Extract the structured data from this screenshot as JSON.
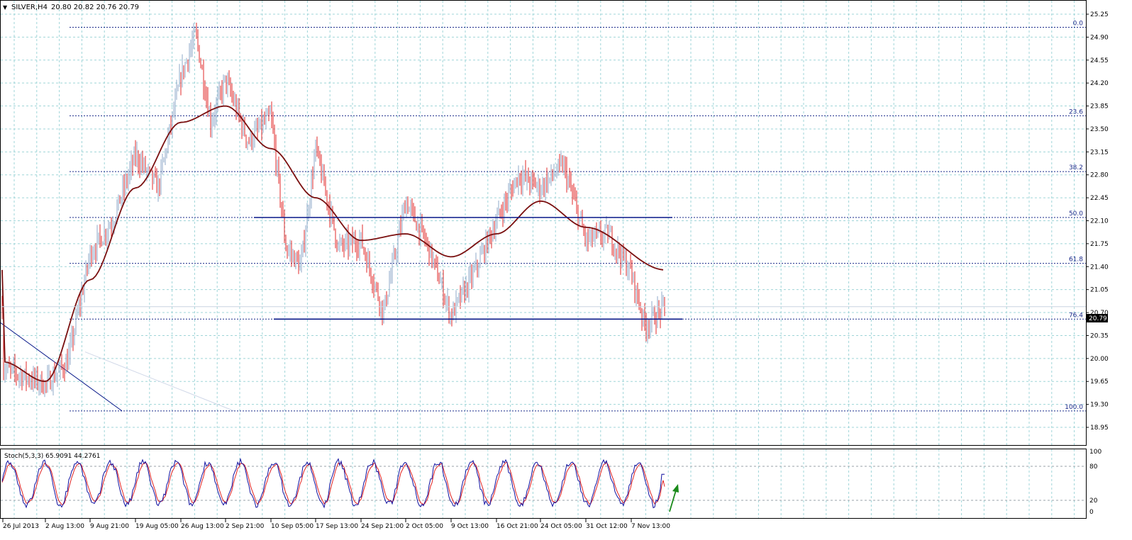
{
  "header": {
    "symbol": "SILVER,H4",
    "ohlc": "20.80 20.82 20.76 20.79",
    "stoch_label": "Stoch(5,3,3) 65.9091 44.2761"
  },
  "colors": {
    "background": "#ffffff",
    "grid": "#9fd5d8",
    "bull": "#8fa8c8",
    "bear": "#e0282a",
    "ma": "#7a1010",
    "level": "#0a1a8a",
    "fib": "#1a2a8a",
    "stoch_main": "#1010a0",
    "stoch_signal": "#e02020",
    "arrow": "#1a8a1a"
  },
  "chart_data": [
    {
      "type": "candlestick",
      "symbol": "SILVER",
      "timeframe": "H4",
      "ylim": [
        18.95,
        25.25
      ],
      "y_ticks": [
        25.25,
        24.9,
        24.55,
        24.2,
        23.85,
        23.5,
        23.15,
        22.8,
        22.45,
        22.1,
        21.75,
        21.4,
        21.05,
        20.7,
        20.35,
        20.0,
        19.65,
        19.3,
        18.95
      ],
      "x_tick_labels": [
        "26 Jul 2013",
        "2 Aug 13:00",
        "9 Aug 21:00",
        "19 Aug 05:00",
        "26 Aug 13:00",
        "2 Sep 21:00",
        "10 Sep 05:00",
        "17 Sep 13:00",
        "24 Sep 21:00",
        "2 Oct 05:00",
        "9 Oct 13:00",
        "16 Oct 21:00",
        "24 Oct 05:00",
        "31 Oct 12:00",
        "7 Nov 13:00"
      ],
      "current_price": 20.79,
      "close_path": [
        {
          "x": "26 Jul 2013",
          "y": 19.85
        },
        {
          "x": "2 Aug 13:00",
          "y": 19.6
        },
        {
          "x": "2 Aug 13:00",
          "y": 19.95
        },
        {
          "x": "9 Aug 21:00",
          "y": 21.6
        },
        {
          "x": "9 Aug 21:00",
          "y": 22.1
        },
        {
          "x": "19 Aug 05:00",
          "y": 23.1
        },
        {
          "x": "19 Aug 05:00",
          "y": 22.6
        },
        {
          "x": "26 Aug 13:00",
          "y": 24.3
        },
        {
          "x": "26 Aug 13:00",
          "y": 24.95
        },
        {
          "x": "26 Aug 13:00",
          "y": 23.6
        },
        {
          "x": "2 Sep 21:00",
          "y": 24.25
        },
        {
          "x": "2 Sep 21:00",
          "y": 23.3
        },
        {
          "x": "10 Sep 05:00",
          "y": 23.7
        },
        {
          "x": "10 Sep 05:00",
          "y": 21.7
        },
        {
          "x": "10 Sep 05:00",
          "y": 21.4
        },
        {
          "x": "17 Sep 13:00",
          "y": 23.2
        },
        {
          "x": "17 Sep 13:00",
          "y": 21.7
        },
        {
          "x": "24 Sep 21:00",
          "y": 21.8
        },
        {
          "x": "24 Sep 21:00",
          "y": 20.7
        },
        {
          "x": "2 Oct 05:00",
          "y": 22.4
        },
        {
          "x": "2 Oct 05:00",
          "y": 21.7
        },
        {
          "x": "9 Oct 13:00",
          "y": 20.65
        },
        {
          "x": "9 Oct 13:00",
          "y": 21.3
        },
        {
          "x": "16 Oct 21:00",
          "y": 22.1
        },
        {
          "x": "16 Oct 21:00",
          "y": 22.8
        },
        {
          "x": "24 Oct 05:00",
          "y": 22.6
        },
        {
          "x": "24 Oct 05:00",
          "y": 22.95
        },
        {
          "x": "31 Oct 12:00",
          "y": 21.8
        },
        {
          "x": "31 Oct 12:00",
          "y": 21.9
        },
        {
          "x": "7 Nov 13:00",
          "y": 21.3
        },
        {
          "x": "7 Nov 13:00",
          "y": 20.5
        },
        {
          "x": "7 Nov 13:00",
          "y": 20.79
        }
      ],
      "moving_average_path": [
        {
          "x": "26 Jul 2013",
          "y": 19.95
        },
        {
          "x": "2 Aug 13:00",
          "y": 19.65
        },
        {
          "x": "9 Aug 21:00",
          "y": 21.2
        },
        {
          "x": "19 Aug 05:00",
          "y": 22.6
        },
        {
          "x": "26 Aug 13:00",
          "y": 23.6
        },
        {
          "x": "2 Sep 21:00",
          "y": 23.85
        },
        {
          "x": "10 Sep 05:00",
          "y": 23.2
        },
        {
          "x": "17 Sep 13:00",
          "y": 22.45
        },
        {
          "x": "24 Sep 21:00",
          "y": 21.8
        },
        {
          "x": "2 Oct 05:00",
          "y": 21.9
        },
        {
          "x": "9 Oct 13:00",
          "y": 21.55
        },
        {
          "x": "16 Oct 21:00",
          "y": 21.9
        },
        {
          "x": "24 Oct 05:00",
          "y": 22.4
        },
        {
          "x": "31 Oct 12:00",
          "y": 22.0
        },
        {
          "x": "7 Nov 13:00",
          "y": 21.35
        }
      ],
      "fibonacci_levels": [
        {
          "label": "0.0",
          "price": 25.05
        },
        {
          "label": "23.6",
          "price": 23.7
        },
        {
          "label": "38.2",
          "price": 22.85
        },
        {
          "label": "50.0",
          "price": 22.15
        },
        {
          "label": "61.8",
          "price": 21.45
        },
        {
          "label": "76.4",
          "price": 20.6
        },
        {
          "label": "100.0",
          "price": 19.2
        }
      ],
      "horizontal_levels": [
        {
          "price": 22.15,
          "from": "10 Sep 05:00",
          "to": "7 Nov 13:00"
        },
        {
          "price": 20.6,
          "from": "10 Sep 05:00",
          "to": "7 Nov 13:00"
        }
      ],
      "trendline": {
        "from": {
          "x": "26 Jul 2013",
          "y": 20.55
        },
        "to": {
          "x": "9 Aug 21:00",
          "y": 19.2
        }
      }
    },
    {
      "type": "line",
      "indicator": "Stoch(5,3,3)",
      "ylim": [
        0,
        100
      ],
      "y_ticks": [
        100,
        80,
        20,
        0
      ],
      "levels": [
        80,
        20
      ],
      "main_last": 65.9091,
      "signal_last": 44.2761,
      "signal_arrow": "up"
    }
  ]
}
